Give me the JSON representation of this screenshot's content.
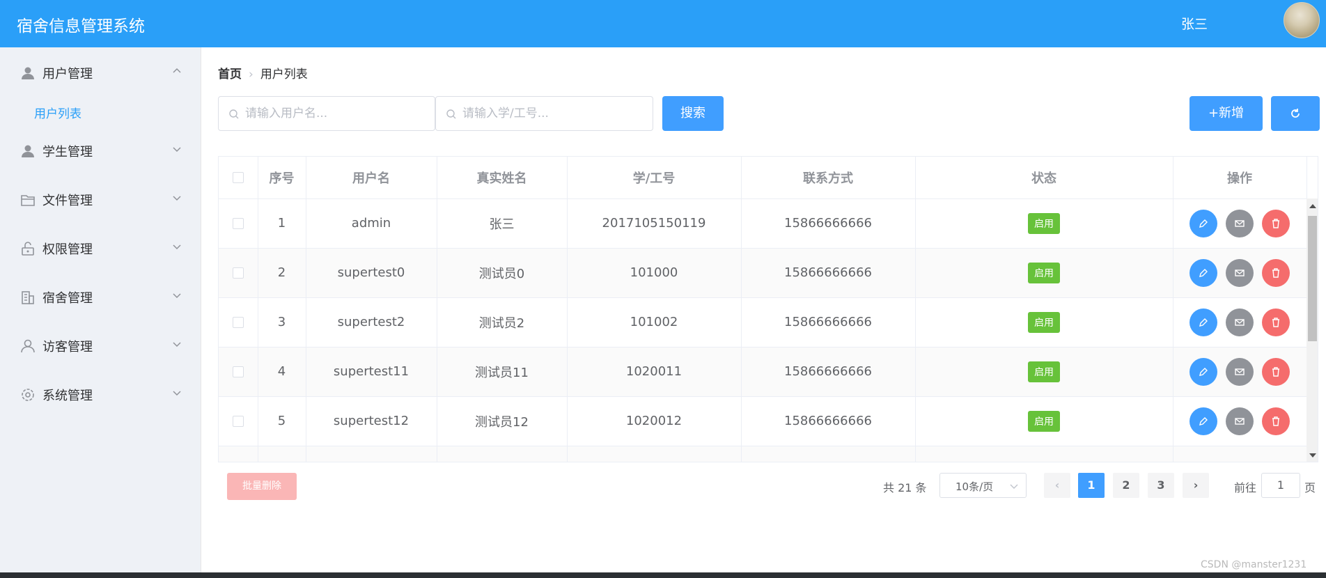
{
  "header": {
    "app_title": "宿舍信息管理系统",
    "user_name": "张三"
  },
  "sidebar": {
    "items": [
      {
        "label": "用户管理",
        "icon": "user-icon",
        "expanded": true
      },
      {
        "label": "学生管理",
        "icon": "student-icon",
        "expanded": false
      },
      {
        "label": "文件管理",
        "icon": "folder-icon",
        "expanded": false
      },
      {
        "label": "权限管理",
        "icon": "lock-icon",
        "expanded": false
      },
      {
        "label": "宿舍管理",
        "icon": "building-icon",
        "expanded": false
      },
      {
        "label": "访客管理",
        "icon": "visitor-icon",
        "expanded": false
      },
      {
        "label": "系统管理",
        "icon": "gear-icon",
        "expanded": false
      }
    ],
    "sub_items": [
      {
        "label": "用户列表",
        "active": true
      }
    ]
  },
  "breadcrumb": {
    "home": "首页",
    "current": "用户列表"
  },
  "toolbar": {
    "username_placeholder": "请输入用户名...",
    "id_placeholder": "请输入学/工号...",
    "search_label": "搜索",
    "add_label": "+新增"
  },
  "table": {
    "columns": [
      "序号",
      "用户名",
      "真实姓名",
      "学/工号",
      "联系方式",
      "状态",
      "操作"
    ],
    "rows": [
      {
        "index": "1",
        "username": "admin",
        "real_name": "张三",
        "id": "2017105150119",
        "phone": "15866666666",
        "status": "启用"
      },
      {
        "index": "2",
        "username": "supertest0",
        "real_name": "测试员0",
        "id": "101000",
        "phone": "15866666666",
        "status": "启用"
      },
      {
        "index": "3",
        "username": "supertest2",
        "real_name": "测试员2",
        "id": "101002",
        "phone": "15866666666",
        "status": "启用"
      },
      {
        "index": "4",
        "username": "supertest11",
        "real_name": "测试员11",
        "id": "1020011",
        "phone": "15866666666",
        "status": "启用"
      },
      {
        "index": "5",
        "username": "supertest12",
        "real_name": "测试员12",
        "id": "1020012",
        "phone": "15866666666",
        "status": "启用"
      }
    ]
  },
  "footer": {
    "batch_delete": "批量删除",
    "total": "共 21 条",
    "page_size": "10条/页",
    "pages": [
      "1",
      "2",
      "3"
    ],
    "current_page": "1",
    "goto_label": "前往",
    "goto_value": "1",
    "page_suffix": "页"
  },
  "watermark": "CSDN @manster1231",
  "colors": {
    "header": "#2a9ff8",
    "primary": "#409eff",
    "success": "#67c23a",
    "danger": "#f56c6c",
    "info": "#909399"
  }
}
